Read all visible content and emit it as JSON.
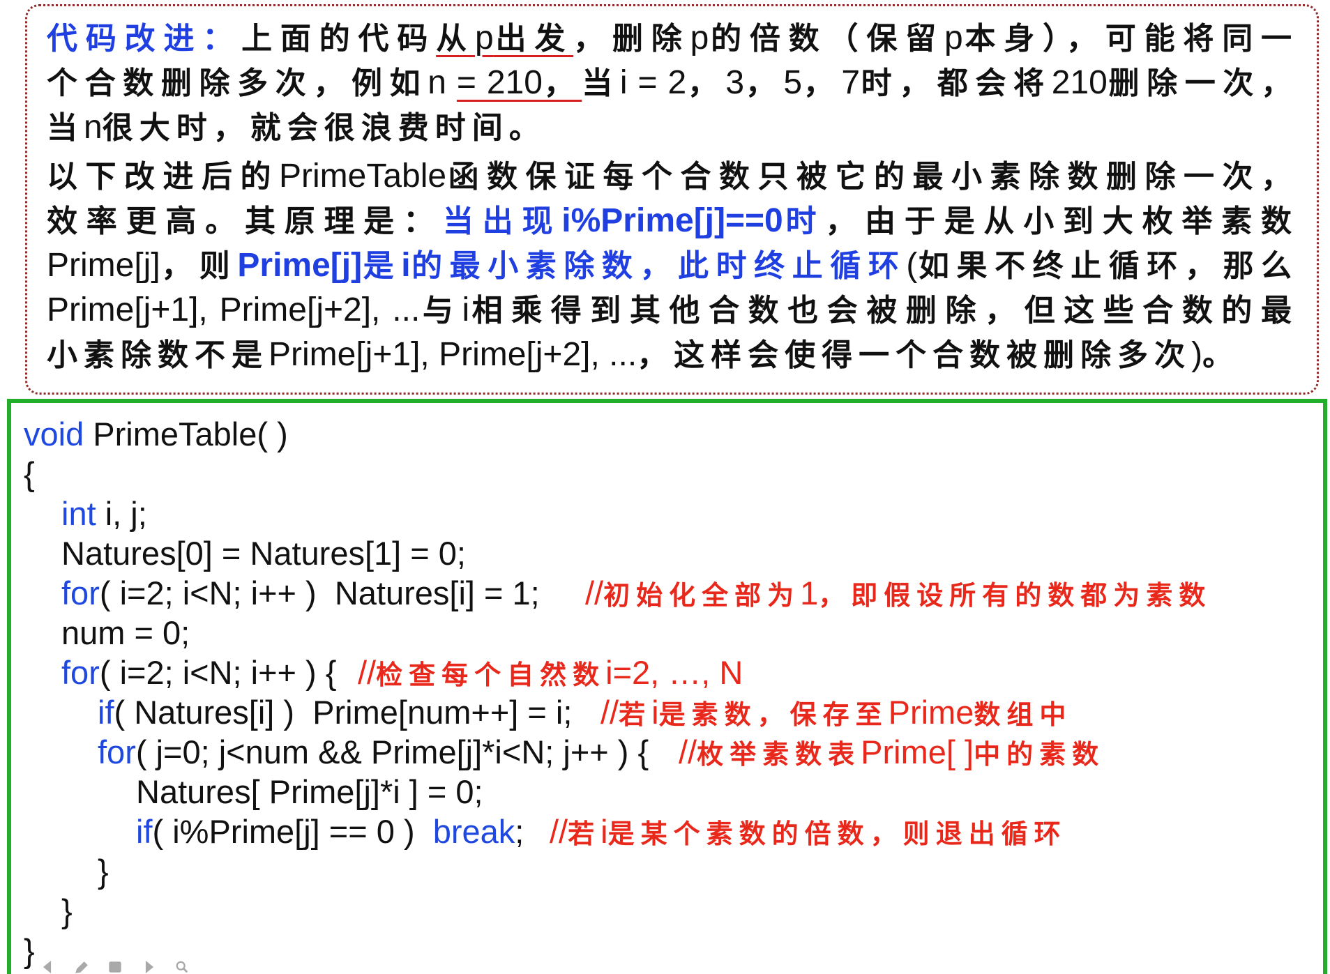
{
  "explanation": {
    "paragraph_1": [
      [
        "代码改进：",
        "上面的代码",
        "从p出发",
        "，删除p的倍数（保留p本身），可能将同一"
      ],
      [
        "个合数删除多次，例如n ",
        "= 210，",
        "当i = 2，3，5，7时，都会将210删除一次，"
      ],
      [
        "当n很大时，就会很浪费时间。"
      ]
    ],
    "paragraph_2": [
      [
        "以下改进后的PrimeTable函数保证每个合数只被它的最小素除数删除一次，"
      ],
      [
        "效率更高。其原理是：",
        "当出现i%Prime[j]==0时",
        "，由于是从小到大枚举素数"
      ],
      [
        "Prime[j]，则",
        "Prime[j]是i的最小素除数，此时终止循环",
        "(如果不终止循环，那么"
      ],
      [
        "Prime[j+1], Prime[j+2], ...与i相乘得到其他合数也会被删除，但这些合数的最"
      ],
      [
        "小素除数不是Prime[j+1], Prime[j+2], ...，这样会使得一个合数被删除多次)。"
      ]
    ]
  },
  "code": {
    "lines": [
      {
        "keyword": "void",
        "text": " PrimeTable( )"
      },
      {
        "text": "{"
      },
      {
        "keyword": "int",
        "text": " i, j;"
      },
      {
        "text": "Natures[0] = Natures[1] = 0;"
      },
      {
        "keyword": "for",
        "text": "( i=2; i<N; i++ )  Natures[i] = 1;",
        "comment": "//初始化全部为1，即假设所有的数都为素数"
      },
      {
        "text": "num = 0;"
      },
      {
        "keyword": "for",
        "text": "( i=2; i<N; i++ ) {",
        "comment": "//检查每个自然数i=2, …, N"
      },
      {
        "keyword": "if",
        "text": "( Natures[i] )  Prime[num++] = i;",
        "comment": "//若i是素数，保存至Prime数组中"
      },
      {
        "keyword": "for",
        "text": "( j=0; j<num && Prime[j]*i<N; j++ ) {",
        "comment": "//枚举素数表Prime[ ]中的素数"
      },
      {
        "text": "Natures[ Prime[j]*i ] = 0;"
      },
      {
        "keyword": "if",
        "text": "( i%Prime[j] == 0 )  ",
        "keyword_2": "break",
        "text_2": ";",
        "comment": "//若i是某个素数的倍数，则退出循环"
      },
      {
        "text": "}"
      },
      {
        "text": "}"
      },
      {
        "text": "}"
      }
    ]
  },
  "slideshow_controls": {
    "icons": [
      "previous-slide-icon",
      "pen-icon",
      "slides-menu-icon",
      "next-slide-icon",
      "zoom-icon"
    ],
    "icon_color": "#555555"
  }
}
